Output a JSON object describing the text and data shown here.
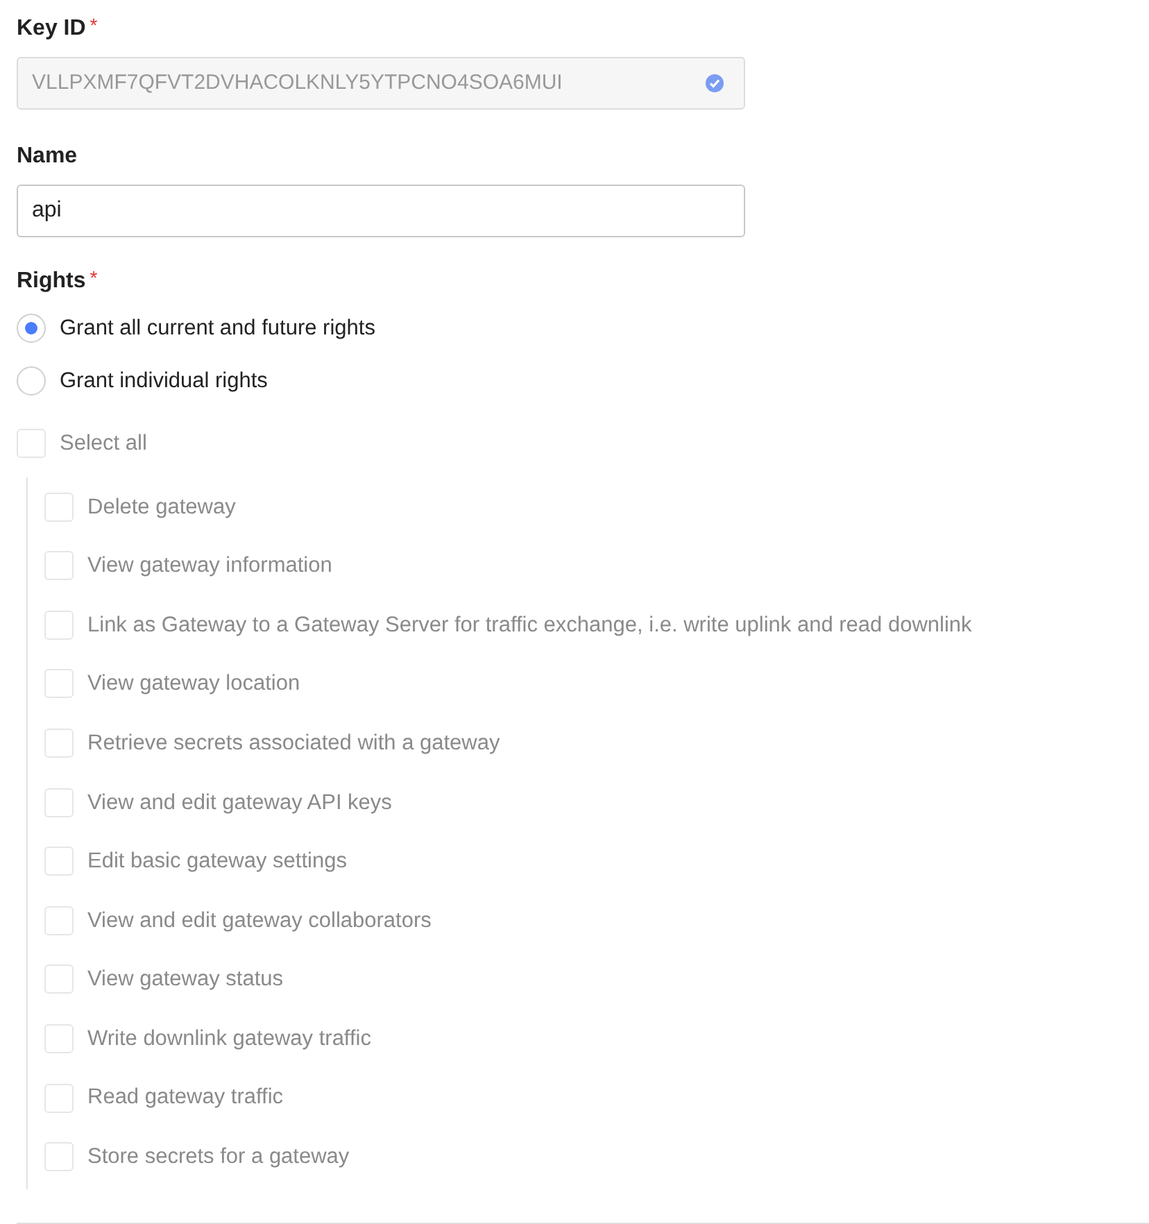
{
  "key_id": {
    "label": "Key ID",
    "required_mark": "*",
    "value": "VLLPXMF7QFVT2DVHACOLKNLY5YTPCNO4SOA6MUI",
    "verified": true
  },
  "name": {
    "label": "Name",
    "value": "api"
  },
  "rights": {
    "label": "Rights",
    "required_mark": "*",
    "options": [
      {
        "label": "Grant all current and future rights",
        "selected": true
      },
      {
        "label": "Grant individual rights",
        "selected": false
      }
    ],
    "select_all": {
      "label": "Select all",
      "checked": false,
      "disabled": true
    },
    "items": [
      {
        "label": "Delete gateway",
        "checked": false,
        "disabled": true
      },
      {
        "label": "View gateway information",
        "checked": false,
        "disabled": true
      },
      {
        "label": "Link as Gateway to a Gateway Server for traffic exchange, i.e. write uplink and read downlink",
        "checked": false,
        "disabled": true
      },
      {
        "label": "View gateway location",
        "checked": false,
        "disabled": true
      },
      {
        "label": "Retrieve secrets associated with a gateway",
        "checked": false,
        "disabled": true
      },
      {
        "label": "View and edit gateway API keys",
        "checked": false,
        "disabled": true
      },
      {
        "label": "Edit basic gateway settings",
        "checked": false,
        "disabled": true
      },
      {
        "label": "View and edit gateway collaborators",
        "checked": false,
        "disabled": true
      },
      {
        "label": "View gateway status",
        "checked": false,
        "disabled": true
      },
      {
        "label": "Write downlink gateway traffic",
        "checked": false,
        "disabled": true
      },
      {
        "label": "Read gateway traffic",
        "checked": false,
        "disabled": true
      },
      {
        "label": "Store secrets for a gateway",
        "checked": false,
        "disabled": true
      }
    ]
  }
}
